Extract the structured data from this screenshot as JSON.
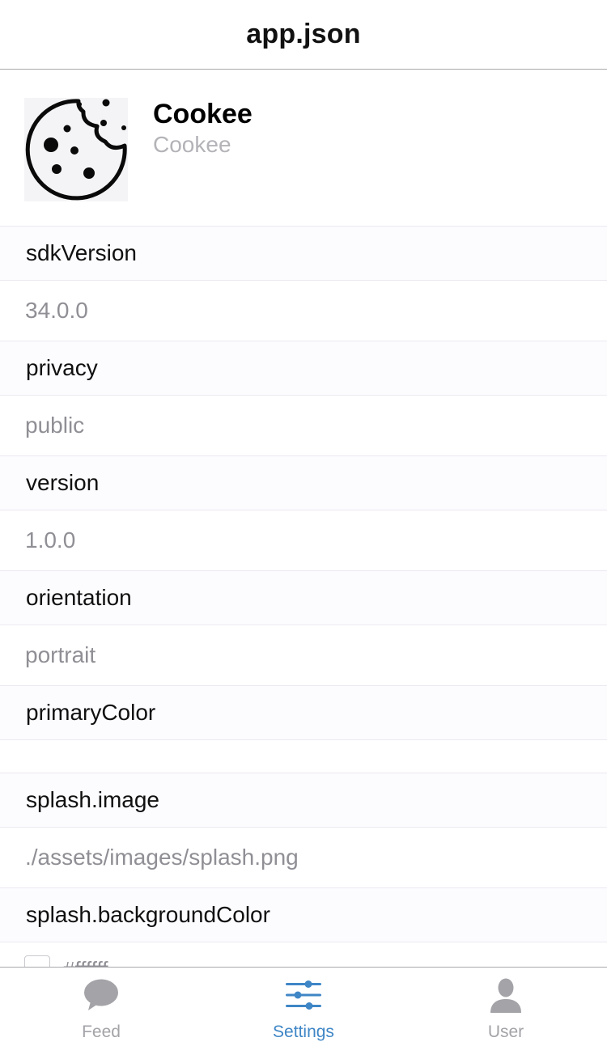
{
  "header": {
    "title": "app.json"
  },
  "app": {
    "name": "Cookee",
    "slug": "Cookee",
    "icon": "cookie-icon"
  },
  "fields": [
    {
      "key": "sdkVersion",
      "value": "34.0.0"
    },
    {
      "key": "privacy",
      "value": "public"
    },
    {
      "key": "version",
      "value": "1.0.0"
    },
    {
      "key": "orientation",
      "value": "portrait"
    },
    {
      "key": "primaryColor",
      "value": ""
    },
    {
      "key": "splash.image",
      "value": "./assets/images/splash.png"
    },
    {
      "key": "splash.backgroundColor",
      "value": "#ffffff",
      "swatch_color": "#ffffff"
    }
  ],
  "tabs": [
    {
      "label": "Feed",
      "icon": "chat-bubble-icon",
      "active": false
    },
    {
      "label": "Settings",
      "icon": "sliders-icon",
      "active": true
    },
    {
      "label": "User",
      "icon": "user-icon",
      "active": false
    }
  ],
  "colors": {
    "accent": "#3f86c6",
    "inactive": "#a3a3a8",
    "value_text": "#8f8f95"
  }
}
